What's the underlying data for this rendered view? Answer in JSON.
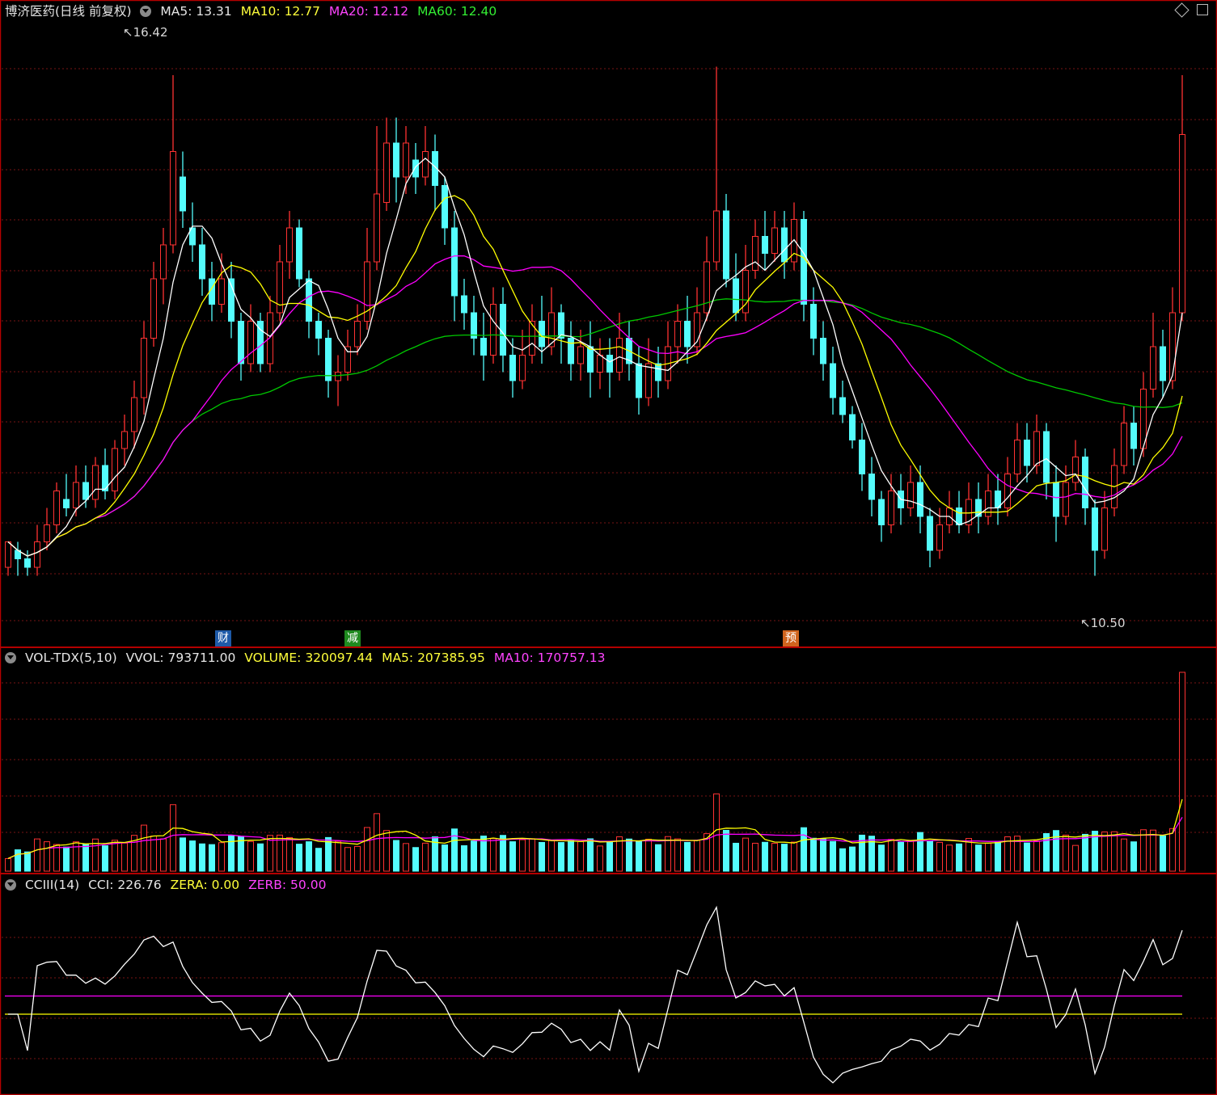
{
  "header": {
    "title": "博济医药(日线 前复权)",
    "ma5": "MA5: 13.31",
    "ma10": "MA10: 12.77",
    "ma20": "MA20: 12.12",
    "ma60": "MA60: 12.40"
  },
  "volume_panel": {
    "name": "VOL-TDX(5,10)",
    "vvol": "VVOL: 793711.00",
    "volume": "VOLUME: 320097.44",
    "ma5": "MA5: 207385.95",
    "ma10": "MA10: 170757.13"
  },
  "cci_panel": {
    "name": "CCIII(14)",
    "cci": "CCI: 226.76",
    "zera": "ZERA: 0.00",
    "zerb": "ZERB: 50.00"
  },
  "price_marks": {
    "high": "16.42",
    "low": "10.50"
  },
  "events": [
    {
      "label": "财",
      "color": "#1e5aa8"
    },
    {
      "label": "减",
      "color": "#1f8a1f"
    },
    {
      "label": "预",
      "color": "#d0641e"
    }
  ],
  "colors": {
    "up": "#ff3232",
    "down": "#54fcfc",
    "ma5": "#ffffff",
    "ma10": "#ffff00",
    "ma20": "#ff00ff",
    "ma60": "#00c800",
    "frame": "#b40000",
    "grid": "#781414"
  },
  "chart_data": {
    "type": "candlestick",
    "price_range": [
      10.0,
      17.0
    ],
    "candles": [
      [
        10.6,
        10.9,
        10.7,
        10.5
      ],
      [
        10.8,
        10.7,
        10.9,
        10.5
      ],
      [
        10.7,
        10.6,
        10.8,
        10.5
      ],
      [
        10.6,
        10.9,
        11.1,
        10.5
      ],
      [
        10.9,
        11.1,
        11.3,
        10.8
      ],
      [
        11.1,
        11.5,
        11.6,
        11.0
      ],
      [
        11.4,
        11.3,
        11.7,
        11.2
      ],
      [
        11.3,
        11.6,
        11.8,
        11.2
      ],
      [
        11.6,
        11.4,
        11.8,
        11.3
      ],
      [
        11.4,
        11.8,
        11.9,
        11.3
      ],
      [
        11.8,
        11.5,
        12.0,
        11.4
      ],
      [
        11.5,
        12.0,
        12.1,
        11.4
      ],
      [
        12.0,
        12.2,
        12.4,
        11.8
      ],
      [
        12.2,
        12.6,
        12.8,
        12.0
      ],
      [
        12.6,
        13.3,
        13.5,
        12.4
      ],
      [
        13.3,
        14.0,
        14.2,
        13.2
      ],
      [
        14.0,
        14.4,
        14.6,
        13.7
      ],
      [
        14.4,
        15.5,
        16.4,
        14.3
      ],
      [
        15.2,
        14.8,
        15.5,
        14.6
      ],
      [
        14.6,
        14.4,
        14.9,
        14.2
      ],
      [
        14.4,
        14.0,
        14.6,
        13.8
      ],
      [
        14.0,
        13.7,
        14.2,
        13.5
      ],
      [
        13.7,
        14.0,
        14.3,
        13.6
      ],
      [
        14.0,
        13.5,
        14.2,
        13.3
      ],
      [
        13.5,
        13.0,
        13.6,
        12.8
      ],
      [
        13.0,
        13.5,
        13.7,
        12.9
      ],
      [
        13.5,
        13.0,
        13.6,
        12.9
      ],
      [
        13.0,
        13.6,
        13.8,
        12.9
      ],
      [
        13.6,
        14.2,
        14.4,
        13.5
      ],
      [
        14.2,
        14.6,
        14.8,
        14.0
      ],
      [
        14.6,
        14.0,
        14.7,
        13.9
      ],
      [
        14.0,
        13.5,
        14.1,
        13.3
      ],
      [
        13.5,
        13.3,
        13.6,
        13.1
      ],
      [
        13.3,
        12.8,
        13.4,
        12.6
      ],
      [
        12.8,
        12.9,
        13.1,
        12.5
      ],
      [
        12.9,
        13.2,
        13.4,
        12.8
      ],
      [
        13.2,
        13.5,
        13.7,
        13.1
      ],
      [
        13.5,
        14.2,
        14.6,
        13.4
      ],
      [
        14.2,
        15.0,
        15.8,
        14.1
      ],
      [
        14.9,
        15.6,
        15.9,
        14.8
      ],
      [
        15.6,
        15.2,
        15.9,
        14.9
      ],
      [
        15.2,
        15.6,
        15.8,
        15.0
      ],
      [
        15.4,
        15.2,
        15.6,
        15.0
      ],
      [
        15.2,
        15.5,
        15.8,
        15.1
      ],
      [
        15.5,
        15.1,
        15.7,
        14.8
      ],
      [
        15.1,
        14.6,
        15.2,
        14.4
      ],
      [
        14.6,
        13.8,
        14.8,
        13.5
      ],
      [
        13.8,
        13.6,
        14.0,
        13.4
      ],
      [
        13.6,
        13.3,
        13.8,
        13.1
      ],
      [
        13.3,
        13.1,
        13.6,
        12.8
      ],
      [
        13.1,
        13.7,
        13.9,
        13.0
      ],
      [
        13.7,
        13.1,
        13.9,
        12.9
      ],
      [
        13.1,
        12.8,
        13.3,
        12.6
      ],
      [
        12.8,
        13.1,
        13.4,
        12.7
      ],
      [
        13.1,
        13.5,
        13.7,
        13.0
      ],
      [
        13.5,
        13.2,
        13.8,
        13.0
      ],
      [
        13.2,
        13.6,
        13.9,
        13.1
      ],
      [
        13.6,
        13.3,
        13.7,
        13.0
      ],
      [
        13.3,
        13.0,
        13.5,
        12.8
      ],
      [
        13.0,
        13.2,
        13.4,
        12.8
      ],
      [
        13.2,
        12.9,
        13.5,
        12.6
      ],
      [
        12.9,
        13.1,
        13.3,
        12.7
      ],
      [
        13.1,
        12.9,
        13.3,
        12.6
      ],
      [
        12.9,
        13.3,
        13.6,
        12.8
      ],
      [
        13.3,
        13.0,
        13.5,
        12.8
      ],
      [
        13.0,
        12.6,
        13.2,
        12.4
      ],
      [
        12.6,
        13.0,
        13.3,
        12.5
      ],
      [
        13.0,
        12.8,
        13.2,
        12.6
      ],
      [
        12.8,
        13.2,
        13.5,
        12.7
      ],
      [
        13.2,
        13.5,
        13.7,
        13.0
      ],
      [
        13.5,
        13.2,
        13.8,
        13.0
      ],
      [
        13.2,
        13.6,
        13.9,
        13.1
      ],
      [
        13.6,
        14.2,
        14.5,
        13.5
      ],
      [
        14.2,
        14.8,
        16.5,
        14.1
      ],
      [
        14.8,
        14.0,
        15.0,
        13.9
      ],
      [
        14.0,
        13.6,
        14.3,
        13.5
      ],
      [
        13.6,
        14.1,
        14.4,
        13.5
      ],
      [
        14.1,
        14.5,
        14.7,
        14.0
      ],
      [
        14.5,
        14.3,
        14.8,
        14.1
      ],
      [
        14.3,
        14.6,
        14.8,
        14.2
      ],
      [
        14.6,
        14.2,
        14.8,
        14.0
      ],
      [
        14.2,
        14.7,
        14.9,
        14.1
      ],
      [
        14.7,
        13.7,
        14.8,
        13.5
      ],
      [
        13.7,
        13.3,
        13.9,
        13.1
      ],
      [
        13.3,
        13.0,
        13.5,
        12.8
      ],
      [
        13.0,
        12.6,
        13.2,
        12.4
      ],
      [
        12.6,
        12.4,
        12.8,
        12.3
      ],
      [
        12.4,
        12.1,
        12.5,
        12.0
      ],
      [
        12.1,
        11.7,
        12.3,
        11.5
      ],
      [
        11.7,
        11.4,
        11.9,
        11.2
      ],
      [
        11.4,
        11.1,
        11.5,
        10.9
      ],
      [
        11.1,
        11.5,
        11.7,
        11.0
      ],
      [
        11.5,
        11.3,
        11.7,
        11.1
      ],
      [
        11.3,
        11.6,
        11.8,
        11.2
      ],
      [
        11.6,
        11.2,
        11.8,
        11.0
      ],
      [
        11.2,
        10.8,
        11.3,
        10.6
      ],
      [
        10.8,
        11.1,
        11.3,
        10.7
      ],
      [
        11.1,
        11.3,
        11.5,
        11.0
      ],
      [
        11.3,
        11.1,
        11.5,
        11.0
      ],
      [
        11.1,
        11.4,
        11.6,
        11.0
      ],
      [
        11.4,
        11.2,
        11.6,
        11.0
      ],
      [
        11.2,
        11.5,
        11.7,
        11.1
      ],
      [
        11.5,
        11.3,
        11.7,
        11.1
      ],
      [
        11.3,
        11.7,
        11.9,
        11.2
      ],
      [
        11.7,
        12.1,
        12.3,
        11.6
      ],
      [
        12.1,
        11.8,
        12.3,
        11.6
      ],
      [
        11.8,
        12.2,
        12.4,
        11.7
      ],
      [
        12.2,
        11.6,
        12.3,
        11.4
      ],
      [
        11.6,
        11.2,
        11.8,
        10.9
      ],
      [
        11.2,
        11.6,
        11.8,
        11.1
      ],
      [
        11.6,
        11.9,
        12.1,
        11.5
      ],
      [
        11.9,
        11.3,
        12.0,
        11.1
      ],
      [
        11.3,
        10.8,
        11.4,
        10.5
      ],
      [
        10.8,
        11.3,
        11.5,
        10.7
      ],
      [
        11.3,
        11.8,
        12.0,
        11.2
      ],
      [
        11.8,
        12.3,
        12.5,
        11.7
      ],
      [
        12.3,
        12.0,
        12.5,
        11.8
      ],
      [
        12.0,
        12.7,
        12.9,
        11.9
      ],
      [
        12.7,
        13.2,
        13.6,
        12.6
      ],
      [
        13.2,
        12.8,
        13.4,
        12.6
      ],
      [
        12.8,
        13.6,
        13.9,
        12.7
      ],
      [
        13.6,
        15.7,
        16.4,
        13.5
      ]
    ]
  }
}
